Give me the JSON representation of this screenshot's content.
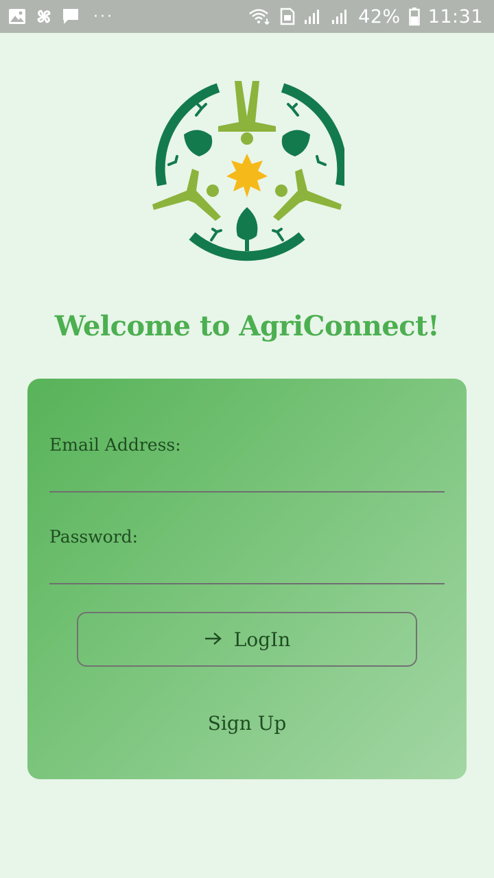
{
  "status_bar": {
    "battery_percent": "42%",
    "time": "11:31",
    "left_icons": [
      "gallery-icon",
      "pinwheel-icon",
      "message-icon",
      "more-dots-icon"
    ],
    "right_icons": [
      "wifi-icon",
      "sim-icon",
      "signal-icon",
      "signal-icon",
      "battery-icon"
    ],
    "more_dots": "···"
  },
  "logo": {
    "icon": "agriconnect-logo-icon"
  },
  "welcome_title": "Welcome to AgriConnect!",
  "login_form": {
    "email_label": "Email Address:",
    "email_value": "",
    "password_label": "Password:",
    "password_value": "",
    "login_button_label": "LogIn",
    "login_icon": "arrow-right-icon",
    "signup_label": "Sign Up"
  },
  "colors": {
    "background": "#e8f5e9",
    "title": "#4caf50",
    "card_gradient_start": "#58b359",
    "card_gradient_end": "#a3d6a4",
    "logo_dark_green": "#137a4d",
    "logo_light_green": "#8cb33c",
    "logo_star": "#f6b91a"
  }
}
